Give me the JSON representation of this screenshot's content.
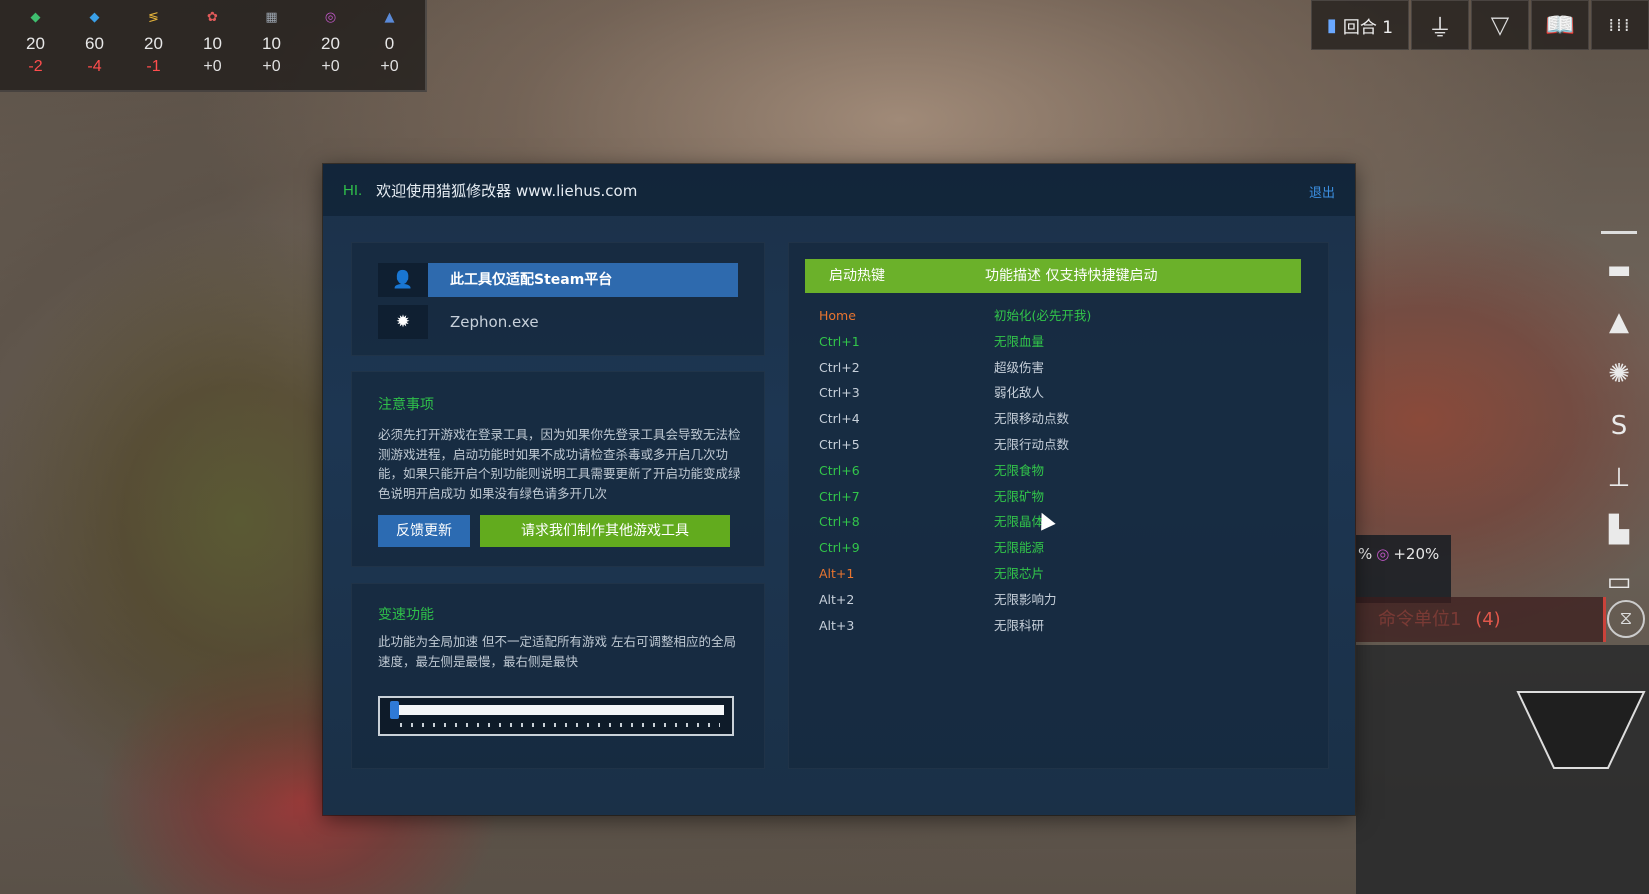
{
  "resources": [
    {
      "icon": "water-drop-icon",
      "color": "#3fbf6f",
      "value": "20",
      "delta": "-2",
      "delta_type": "neg"
    },
    {
      "icon": "crystal-icon",
      "color": "#3aa0e8",
      "value": "60",
      "delta": "-4",
      "delta_type": "neg"
    },
    {
      "icon": "energy-bolt-icon",
      "color": "#e3b23a",
      "value": "20",
      "delta": "-1",
      "delta_type": "neg"
    },
    {
      "icon": "population-icon",
      "color": "#e05a5a",
      "value": "10",
      "delta": "+0",
      "delta_type": "zero"
    },
    {
      "icon": "chip-icon",
      "color": "#9aa3ad",
      "value": "10",
      "delta": "+0",
      "delta_type": "zero"
    },
    {
      "icon": "influence-icon",
      "color": "#c257c8",
      "value": "20",
      "delta": "+0",
      "delta_type": "zero"
    },
    {
      "icon": "science-flask-icon",
      "color": "#5a8ad8",
      "value": "0",
      "delta": "+0",
      "delta_type": "zero"
    }
  ],
  "top_right": {
    "turn_label": "回合 1",
    "buttons": [
      "beacon-icon",
      "faction-triangle-icon",
      "codex-book-icon",
      "grid-menu-icon"
    ]
  },
  "side_panel": {
    "partial_text": "%",
    "influence_bonus": "+20%",
    "command_text": "命令单位1",
    "command_count": "(4)"
  },
  "dialog": {
    "hi": "HI.",
    "title": "欢迎使用猎狐修改器 www.liehus.com",
    "exit": "退出",
    "platform_label": "此工具仅适配Steam平台",
    "process_name": "Zephon.exe",
    "notice_title": "注意事项",
    "notice_body": "必须先打开游戏在登录工具，因为如果你先登录工具会导致无法检测游戏进程，启动功能时如果不成功请检查杀毒或多开启几次功能，如果只能开启个别功能则说明工具需要更新了开启功能变成绿色说明开启成功 如果没有绿色请多开几次",
    "feedback_button": "反馈更新",
    "request_button": "请求我们制作其他游戏工具",
    "speed_title": "变速功能",
    "speed_body": "此功能为全局加速 但不一定适配所有游戏 左右可调整相应的全局速度，最左侧是最慢，最右侧是最快",
    "speed_value": 0,
    "hotkey_header": "启动热键",
    "desc_header": "功能描述 仅支持快捷键启动",
    "hotkeys": [
      {
        "key": "Home",
        "desc": "初始化(必先开我)",
        "key_state": "orange",
        "desc_state": "green"
      },
      {
        "key": "Ctrl+1",
        "desc": "无限血量",
        "key_state": "green",
        "desc_state": "green"
      },
      {
        "key": "Ctrl+2",
        "desc": "超级伤害",
        "key_state": "off",
        "desc_state": "off"
      },
      {
        "key": "Ctrl+3",
        "desc": "弱化敌人",
        "key_state": "off",
        "desc_state": "off"
      },
      {
        "key": "Ctrl+4",
        "desc": "无限移动点数",
        "key_state": "off",
        "desc_state": "off"
      },
      {
        "key": "Ctrl+5",
        "desc": "无限行动点数",
        "key_state": "off",
        "desc_state": "off"
      },
      {
        "key": "Ctrl+6",
        "desc": "无限食物",
        "key_state": "green",
        "desc_state": "green"
      },
      {
        "key": "Ctrl+7",
        "desc": "无限矿物",
        "key_state": "green",
        "desc_state": "green"
      },
      {
        "key": "Ctrl+8",
        "desc": "无限晶体",
        "key_state": "green",
        "desc_state": "green"
      },
      {
        "key": "Ctrl+9",
        "desc": "无限能源",
        "key_state": "green",
        "desc_state": "green"
      },
      {
        "key": "Alt+1",
        "desc": "无限芯片",
        "key_state": "orange",
        "desc_state": "green"
      },
      {
        "key": "Alt+2",
        "desc": "无限影响力",
        "key_state": "off",
        "desc_state": "off"
      },
      {
        "key": "Alt+3",
        "desc": "无限科研",
        "key_state": "off",
        "desc_state": "off"
      }
    ]
  }
}
